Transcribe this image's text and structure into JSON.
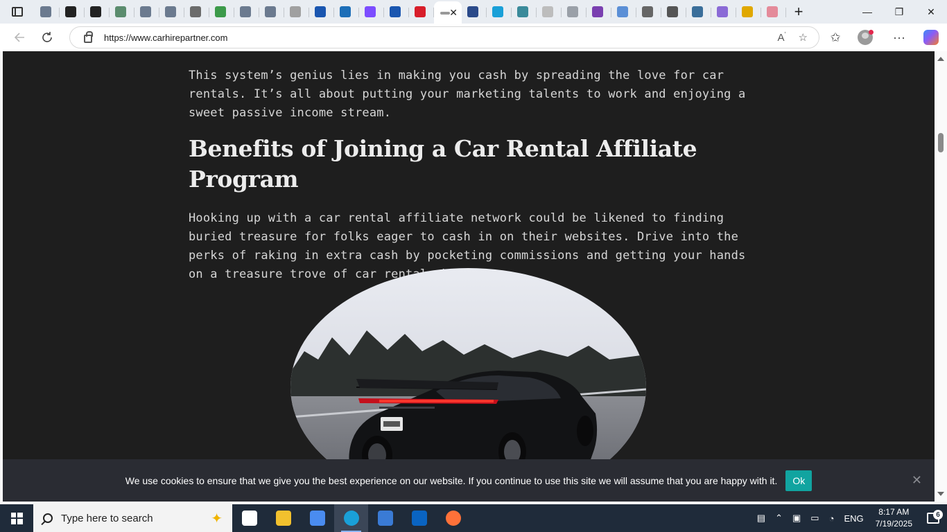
{
  "browser": {
    "tabs": [
      {
        "icon": "search-icon",
        "color": "#6b7a8f"
      },
      {
        "icon": "openai-icon",
        "color": "#222222"
      },
      {
        "icon": "bing-chat-icon",
        "color": "#222222"
      },
      {
        "icon": "m-icon",
        "color": "#5b8c6e"
      },
      {
        "icon": "search-icon",
        "color": "#6b7a8f"
      },
      {
        "icon": "search-icon",
        "color": "#6b7a8f"
      },
      {
        "icon": "n-icon",
        "color": "#6b6b6b"
      },
      {
        "icon": "globe-green-icon",
        "color": "#3c9a4a"
      },
      {
        "icon": "search-icon",
        "color": "#6b7a8f"
      },
      {
        "icon": "search-icon",
        "color": "#6b7a8f"
      },
      {
        "icon": "gray-icon",
        "color": "#a0a0a0"
      },
      {
        "icon": "search-icon",
        "color": "#1a56b0"
      },
      {
        "icon": "xf-icon",
        "color": "#1d6fb8"
      },
      {
        "icon": "e-purple-icon",
        "color": "#7c4dff"
      },
      {
        "icon": "search-icon",
        "color": "#1a56b0"
      },
      {
        "icon": "red-circle-icon",
        "color": "#d81e2a"
      }
    ],
    "tabs_after_active": [
      {
        "icon": "car-icon",
        "color": "#2b4a8a"
      },
      {
        "icon": "c-icon",
        "color": "#1aa0d8"
      },
      {
        "icon": "triangle-icon",
        "color": "#3a8a9a"
      },
      {
        "icon": "pill-icon",
        "color": "#bdbdbd"
      },
      {
        "icon": "gear-icon",
        "color": "#9aa0a8"
      },
      {
        "icon": "u-icon",
        "color": "#7a3fb0"
      },
      {
        "icon": "p-icon",
        "color": "#5b8fd6"
      },
      {
        "icon": "globe-icon",
        "color": "#666666"
      },
      {
        "icon": "list-icon",
        "color": "#555555"
      },
      {
        "icon": "boat-icon",
        "color": "#3a6e9a"
      },
      {
        "icon": "purple-icon",
        "color": "#8a6ad6"
      },
      {
        "icon": "c-yellow-icon",
        "color": "#e0a800"
      },
      {
        "icon": "pink-icon",
        "color": "#e48a9a"
      }
    ],
    "url": "https://www.carhirepartner.com"
  },
  "article": {
    "intro": "This system’s genius lies in making you cash by spreading the love for car rentals. It’s all about putting your marketing talents to work and enjoying a sweet passive income stream.",
    "heading": "Benefits of Joining a Car Rental Affiliate Program",
    "body": "Hooking up with a car rental affiliate network could be likened to finding buried treasure for folks eager to cash in on their websites. Drive into the perks of raking in extra cash by pocketing commissions and getting your hands on a treasure trove of car rental choices."
  },
  "cookie": {
    "text": "We use cookies to ensure that we give you the best experience on our website. If you continue to use this site we will assume that you are happy with it.",
    "ok": "Ok",
    "close": "✕"
  },
  "taskbar": {
    "search_placeholder": "Type here to search",
    "apps": [
      {
        "name": "task-view",
        "color": "#ffffff"
      },
      {
        "name": "file-explorer",
        "color": "#f2c12e"
      },
      {
        "name": "copilot",
        "color": "#4a8cf0"
      },
      {
        "name": "edge",
        "color": "#1aa0d8"
      },
      {
        "name": "store",
        "color": "#3a7bd5"
      },
      {
        "name": "outlook",
        "color": "#0a64c2"
      },
      {
        "name": "firefox",
        "color": "#ff7139"
      }
    ],
    "lang": "ENG",
    "time": "8:17 AM",
    "date": "7/19/2025",
    "notifications": "6"
  }
}
